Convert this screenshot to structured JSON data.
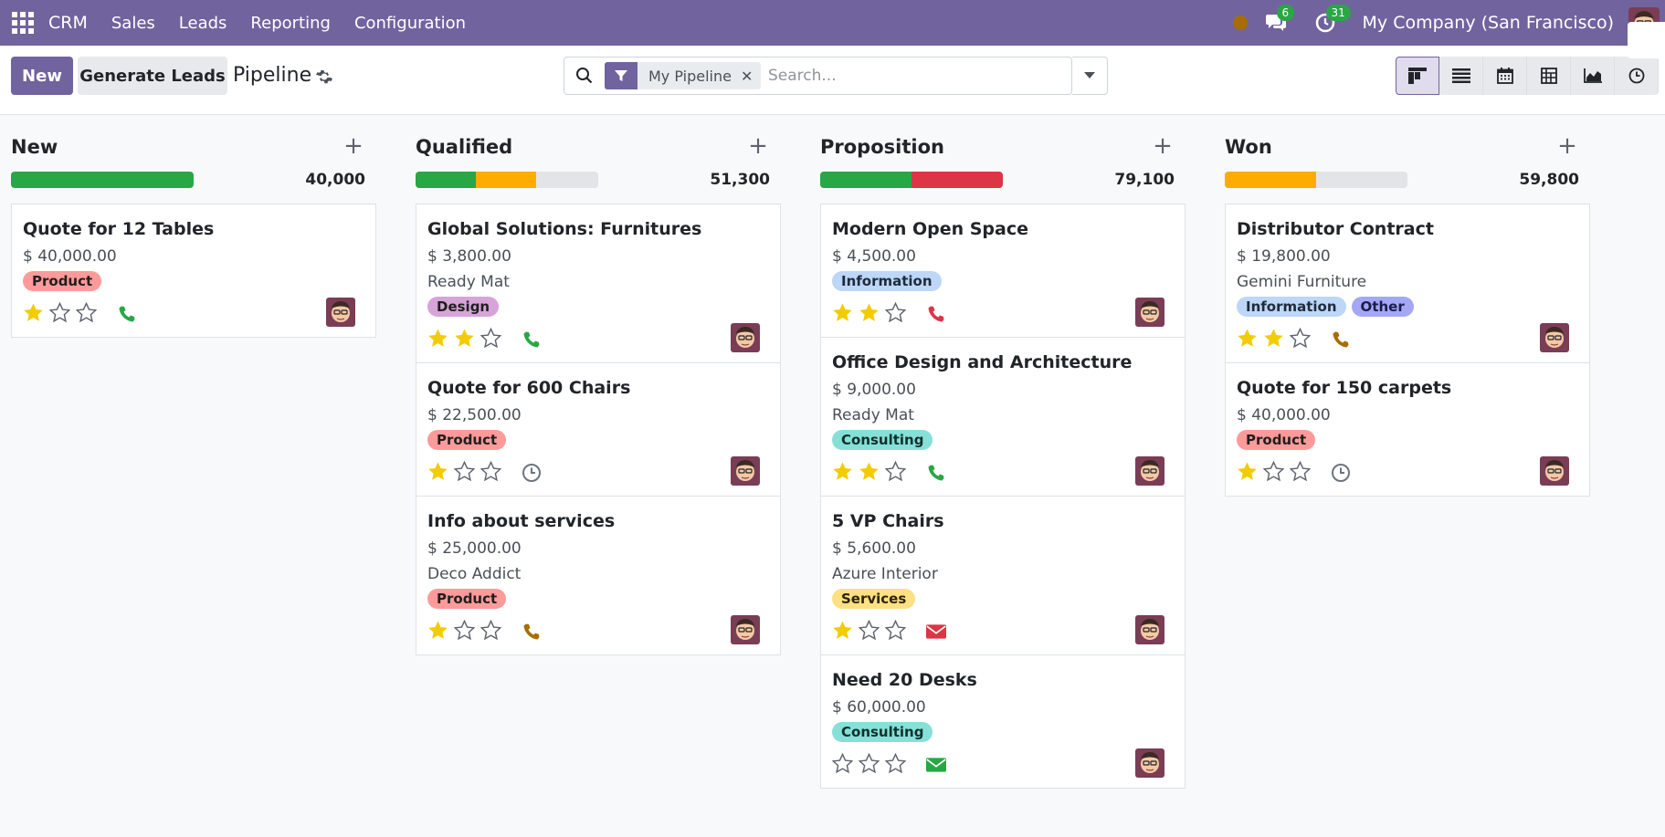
{
  "nav": {
    "brand": "CRM",
    "menu": [
      "Sales",
      "Leads",
      "Reporting",
      "Configuration"
    ],
    "messages_count": "6",
    "activities_count": "31",
    "company": "My Company (San Francisco)"
  },
  "control": {
    "new_label": "New",
    "generate_label": "Generate Leads",
    "title": "Pipeline",
    "facet_value": "My Pipeline",
    "search_placeholder": "Search..."
  },
  "colors": {
    "primary": "#71639e",
    "green": "#28a745",
    "orange": "#ffac00",
    "red": "#dc3545",
    "grey": "#e2e4e8"
  },
  "columns": [
    {
      "title": "New",
      "total": "40,000",
      "progress": [
        {
          "color": "#28a745",
          "pct": 100
        }
      ],
      "cards": [
        {
          "title": "Quote for 12 Tables",
          "amount": "$ 40,000.00",
          "partner": "",
          "tags": [
            {
              "label": "Product",
              "color": "product"
            }
          ],
          "stars": 1,
          "activity": "phone",
          "activity_color": "#28a745"
        }
      ]
    },
    {
      "title": "Qualified",
      "total": "51,300",
      "progress": [
        {
          "color": "#28a745",
          "pct": 33
        },
        {
          "color": "#ffac00",
          "pct": 33
        }
      ],
      "cards": [
        {
          "title": "Global Solutions: Furnitures",
          "amount": "$ 3,800.00",
          "partner": "Ready Mat",
          "tags": [
            {
              "label": "Design",
              "color": "design"
            }
          ],
          "stars": 2,
          "activity": "phone",
          "activity_color": "#28a745"
        },
        {
          "title": "Quote for 600 Chairs",
          "amount": "$ 22,500.00",
          "partner": "",
          "tags": [
            {
              "label": "Product",
              "color": "product"
            }
          ],
          "stars": 1,
          "activity": "clock",
          "activity_color": "#6c757d"
        },
        {
          "title": "Info about services",
          "amount": "$ 25,000.00",
          "partner": "Deco Addict",
          "tags": [
            {
              "label": "Product",
              "color": "product"
            }
          ],
          "stars": 1,
          "activity": "phone",
          "activity_color": "#a66d00"
        }
      ]
    },
    {
      "title": "Proposition",
      "total": "79,100",
      "progress": [
        {
          "color": "#28a745",
          "pct": 50
        },
        {
          "color": "#dc3545",
          "pct": 50
        }
      ],
      "cards": [
        {
          "title": "Modern Open Space",
          "amount": "$ 4,500.00",
          "partner": "",
          "tags": [
            {
              "label": "Information",
              "color": "information"
            }
          ],
          "stars": 2,
          "activity": "phone",
          "activity_color": "#dc3545"
        },
        {
          "title": "Office Design and Architecture",
          "amount": "$ 9,000.00",
          "partner": "Ready Mat",
          "tags": [
            {
              "label": "Consulting",
              "color": "consulting"
            }
          ],
          "stars": 2,
          "activity": "phone",
          "activity_color": "#28a745"
        },
        {
          "title": "5 VP Chairs",
          "amount": "$ 5,600.00",
          "partner": "Azure Interior",
          "tags": [
            {
              "label": "Services",
              "color": "services"
            }
          ],
          "stars": 1,
          "activity": "email",
          "activity_color": "#dc3545"
        },
        {
          "title": "Need 20 Desks",
          "amount": "$ 60,000.00",
          "partner": "",
          "tags": [
            {
              "label": "Consulting",
              "color": "consulting"
            }
          ],
          "stars": 0,
          "activity": "email",
          "activity_color": "#28a745"
        }
      ]
    },
    {
      "title": "Won",
      "total": "59,800",
      "progress": [
        {
          "color": "#ffac00",
          "pct": 50
        }
      ],
      "cards": [
        {
          "title": "Distributor Contract",
          "amount": "$ 19,800.00",
          "partner": "Gemini Furniture",
          "tags": [
            {
              "label": "Information",
              "color": "information"
            },
            {
              "label": "Other",
              "color": "other"
            }
          ],
          "stars": 2,
          "activity": "phone",
          "activity_color": "#a66d00"
        },
        {
          "title": "Quote for 150 carpets",
          "amount": "$ 40,000.00",
          "partner": "",
          "tags": [
            {
              "label": "Product",
              "color": "product"
            }
          ],
          "stars": 1,
          "activity": "clock",
          "activity_color": "#6c757d"
        }
      ]
    }
  ]
}
